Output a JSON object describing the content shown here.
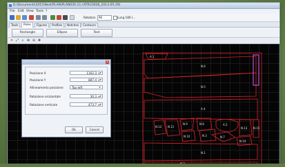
{
  "window": {
    "title": "D:\\Documenti\\2015\\Nest\\PLAN\\PLAN030 (1) (ATRU3028_2013-05-29)"
  },
  "menu": [
    "File",
    "Edit",
    "View",
    "Tools",
    "?"
  ],
  "toolbar": {
    "rotation_label": "Rotation",
    "rotation_value": "90",
    "symmetry_label": "Lung 180 I..."
  },
  "tabs": [
    "Tools",
    "Poles",
    "Figures",
    "Profiles",
    "Notches",
    "Contours"
  ],
  "active_tab_index": 1,
  "shape_buttons": [
    "Rectangle",
    "Ellipse",
    "Text"
  ],
  "view_tools": [
    "✕",
    "⤢",
    "⌕",
    "⊕",
    "⊖",
    "✥"
  ],
  "dialog": {
    "fields": [
      {
        "label": "Posizione X",
        "value": "1162.3"
      },
      {
        "label": "Posizione Y",
        "value": "887.4"
      },
      {
        "label": "Allineamento posizione",
        "value": "Top-left"
      },
      {
        "label": "Rotazione orizzontale",
        "value": "30.3"
      },
      {
        "label": "Rotazione verticale",
        "value": "473.7"
      }
    ],
    "ok_label": "Ok",
    "cancel_label": "Cancel"
  },
  "pieces": [
    "A.1",
    "N.6",
    "N.5",
    "A.4",
    "N.12",
    "N.11",
    "N.9",
    "N.10",
    "N.8",
    "N.3",
    "A.2",
    "N.15",
    "N.13",
    "N.7",
    "N.14",
    "N.1",
    "N.2"
  ],
  "colors": {
    "canvas_bg": "#050505",
    "piece_outline": "#e0242c",
    "selected_piece": "#c24fd6",
    "window_chrome": "#e9edf2"
  }
}
